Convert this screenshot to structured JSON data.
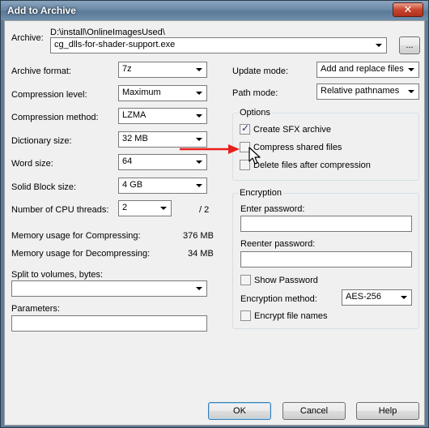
{
  "window": {
    "title": "Add to Archive",
    "close_glyph": "✕"
  },
  "archive": {
    "label": "Archive:",
    "path": "D:\\install\\OnlineImagesUsed\\",
    "filename": "cg_dlls-for-shader-support.exe",
    "browse_label": "..."
  },
  "left": {
    "archive_format": {
      "label": "Archive format:",
      "value": "7z"
    },
    "compression_level": {
      "label": "Compression level:",
      "value": "Maximum"
    },
    "compression_method": {
      "label": "Compression method:",
      "value": "LZMA"
    },
    "dictionary_size": {
      "label": "Dictionary size:",
      "value": "32 MB"
    },
    "word_size": {
      "label": "Word size:",
      "value": "64"
    },
    "solid_block_size": {
      "label": "Solid Block size:",
      "value": "4 GB"
    },
    "cpu_threads": {
      "label": "Number of CPU threads:",
      "value": "2",
      "max": "/ 2"
    },
    "mem_compress": {
      "label": "Memory usage for Compressing:",
      "value": "376 MB"
    },
    "mem_decompress": {
      "label": "Memory usage for Decompressing:",
      "value": "34 MB"
    },
    "split_volumes": {
      "label": "Split to volumes, bytes:",
      "value": ""
    },
    "parameters": {
      "label": "Parameters:",
      "value": ""
    }
  },
  "right": {
    "update_mode": {
      "label": "Update mode:",
      "value": "Add and replace files"
    },
    "path_mode": {
      "label": "Path mode:",
      "value": "Relative pathnames"
    },
    "options": {
      "title": "Options",
      "create_sfx": {
        "label": "Create SFX archive",
        "checked": true
      },
      "compress_shared": {
        "label": "Compress shared files",
        "checked": false
      },
      "delete_after": {
        "label": "Delete files after compression",
        "checked": false
      }
    },
    "encryption": {
      "title": "Encryption",
      "enter_password_label": "Enter password:",
      "reenter_password_label": "Reenter password:",
      "show_password": {
        "label": "Show Password",
        "checked": false
      },
      "method_label": "Encryption method:",
      "method_value": "AES-256",
      "encrypt_names": {
        "label": "Encrypt file names",
        "checked": false
      }
    }
  },
  "buttons": {
    "ok": "OK",
    "cancel": "Cancel",
    "help": "Help"
  },
  "colors": {
    "annotation_arrow": "#e8201c",
    "titlebar": "#6b8aa8"
  }
}
